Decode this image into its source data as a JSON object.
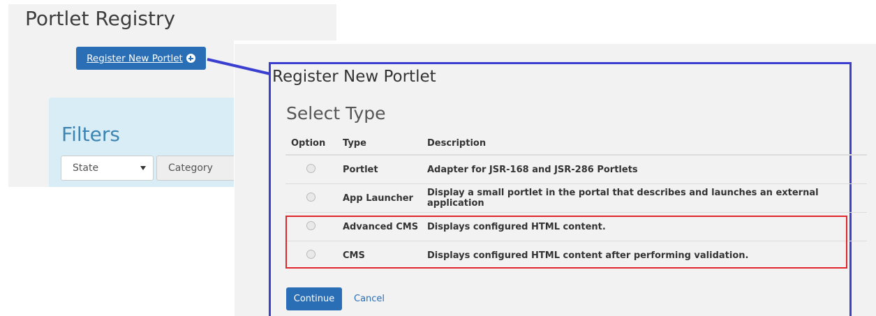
{
  "background_page": {
    "title": "Portlet Registry",
    "register_button": {
      "label": "Register New Portlet"
    },
    "filters": {
      "title": "Filters",
      "state_select": "State",
      "category_select": "Category"
    }
  },
  "dialog": {
    "title": "Register New Portlet",
    "section_title": "Select Type",
    "columns": [
      "Option",
      "Type",
      "Description"
    ],
    "rows": [
      {
        "type": "Portlet",
        "description": "Adapter for JSR-168 and JSR-286 Portlets"
      },
      {
        "type": "App Launcher",
        "description": "Display a small portlet in the portal that describes and launches an external application"
      },
      {
        "type": "Advanced CMS",
        "description": "Displays configured HTML content."
      },
      {
        "type": "CMS",
        "description": "Displays configured HTML content after performing validation."
      }
    ],
    "continue_label": "Continue",
    "cancel_label": "Cancel"
  },
  "colors": {
    "primary": "#2a6eb5",
    "frame_outline": "#3b3fd0",
    "highlight_outline": "#e0262b",
    "filters_bg": "#d9edf7"
  }
}
